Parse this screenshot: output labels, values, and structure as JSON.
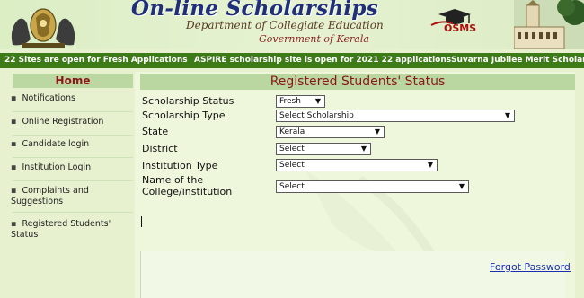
{
  "header": {
    "title": "On-line Scholarships",
    "department": "Department of Collegiate Education",
    "government": "Government of Kerala",
    "logo_text": "OSMS"
  },
  "ticker": {
    "items": [
      "22 Sites are open for Fresh Applications",
      "ASPIRE scholarship site is open for 2021 22 applications",
      "Suvarna Jubilee Merit Scholarship"
    ]
  },
  "sidebar": {
    "home": "Home",
    "items": [
      {
        "label": "Notifications"
      },
      {
        "label": "Online Registration"
      },
      {
        "label": "Candidate login"
      },
      {
        "label": "Institution Login"
      },
      {
        "label": "Complaints and Suggestions"
      },
      {
        "label": "Registered Students' Status"
      }
    ]
  },
  "main": {
    "title": "Registered Students' Status",
    "fields": [
      {
        "label": "Scholarship Status",
        "value": "Fresh"
      },
      {
        "label": "Scholarship Type",
        "value": "Select Scholarship"
      },
      {
        "label": "State",
        "value": "Kerala"
      },
      {
        "label": "District",
        "value": "Select"
      },
      {
        "label": "Institution Type",
        "value": "Select"
      },
      {
        "label": "Name of the College/institution",
        "value": "Select"
      }
    ],
    "forgot_password": "Forgot Password"
  },
  "colors": {
    "ticker_bg": "#3d7a18",
    "title_text": "#8a1818",
    "panel_header_bg": "#bad7a1",
    "page_bg": "#e7f1cf",
    "link": "#1a2fb0"
  }
}
